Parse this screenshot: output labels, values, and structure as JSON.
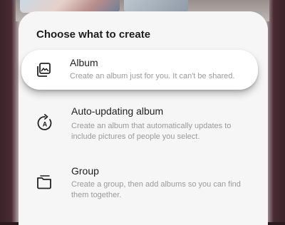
{
  "sheet": {
    "title": "Choose what to create",
    "options": [
      {
        "title": "Album",
        "description": "Create an album just for you. It can't be shared.",
        "icon": "album-icon"
      },
      {
        "title": "Auto-updating album",
        "description": "Create an album that automatically updates to include pictures of people you select.",
        "icon": "auto-album-icon"
      },
      {
        "title": "Group",
        "description": "Create a group, then add albums so you can find them together.",
        "icon": "group-folder-icon"
      }
    ]
  }
}
